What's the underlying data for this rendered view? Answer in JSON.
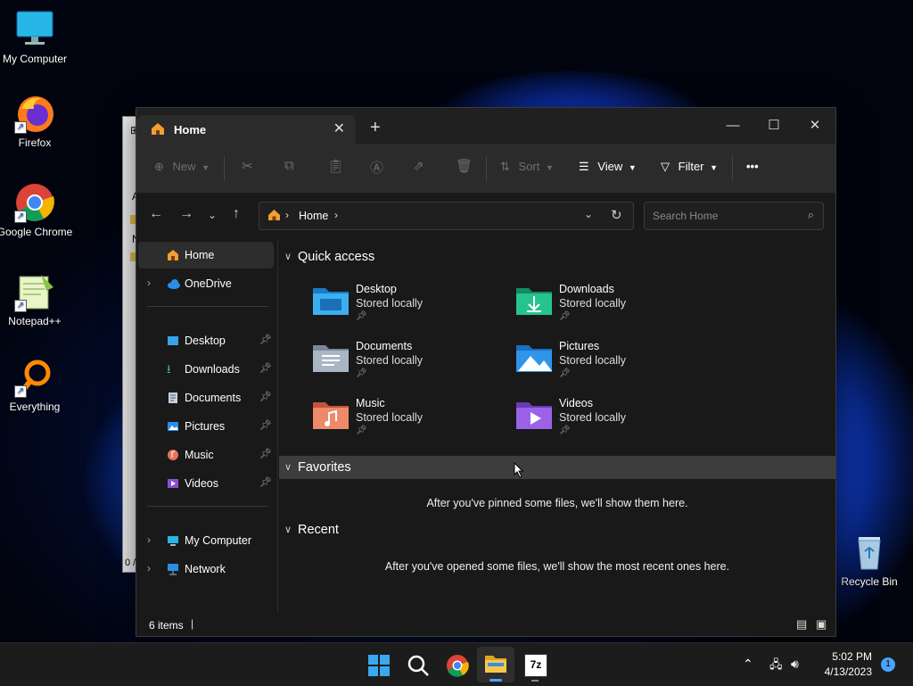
{
  "desktop": {
    "icons": [
      {
        "label": "My Computer"
      },
      {
        "label": "Firefox"
      },
      {
        "label": "Google Chrome"
      },
      {
        "label": "Notepad++"
      },
      {
        "label": "Everything"
      },
      {
        "label": "Recycle Bin"
      }
    ]
  },
  "explorer": {
    "tab_title": "Home",
    "toolbar": {
      "new": "New",
      "sort": "Sort",
      "view": "View",
      "filter": "Filter",
      "more": "•••"
    },
    "address": {
      "crumb": "Home",
      "search_placeholder": "Search Home"
    },
    "sidebar": {
      "home": "Home",
      "onedrive": "OneDrive",
      "pinned": [
        "Desktop",
        "Downloads",
        "Documents",
        "Pictures",
        "Music",
        "Videos"
      ],
      "my_computer": "My Computer",
      "network": "Network"
    },
    "quick_access": {
      "title": "Quick access",
      "items": [
        {
          "name": "Desktop",
          "status": "Stored locally"
        },
        {
          "name": "Downloads",
          "status": "Stored locally"
        },
        {
          "name": "Documents",
          "status": "Stored locally"
        },
        {
          "name": "Pictures",
          "status": "Stored locally"
        },
        {
          "name": "Music",
          "status": "Stored locally"
        },
        {
          "name": "Videos",
          "status": "Stored locally"
        }
      ]
    },
    "favorites": {
      "title": "Favorites",
      "empty": "After you've pinned some files, we'll show them here."
    },
    "recent": {
      "title": "Recent",
      "empty": "After you've opened some files, we'll show the most recent ones here."
    },
    "status": {
      "count": "6 items"
    }
  },
  "bg_window": {
    "label_a": "A",
    "label_n": "N",
    "label_0": "0 /"
  },
  "taskbar": {
    "time": "5:02 PM",
    "date": "4/13/2023",
    "notifications": "1",
    "app_7z": "7z"
  },
  "colors": {
    "accent": "#4aa3ff",
    "window_bg": "#191919",
    "toolbar_bg": "#2b2b2b",
    "favorites_band": "#3d3d3d"
  }
}
